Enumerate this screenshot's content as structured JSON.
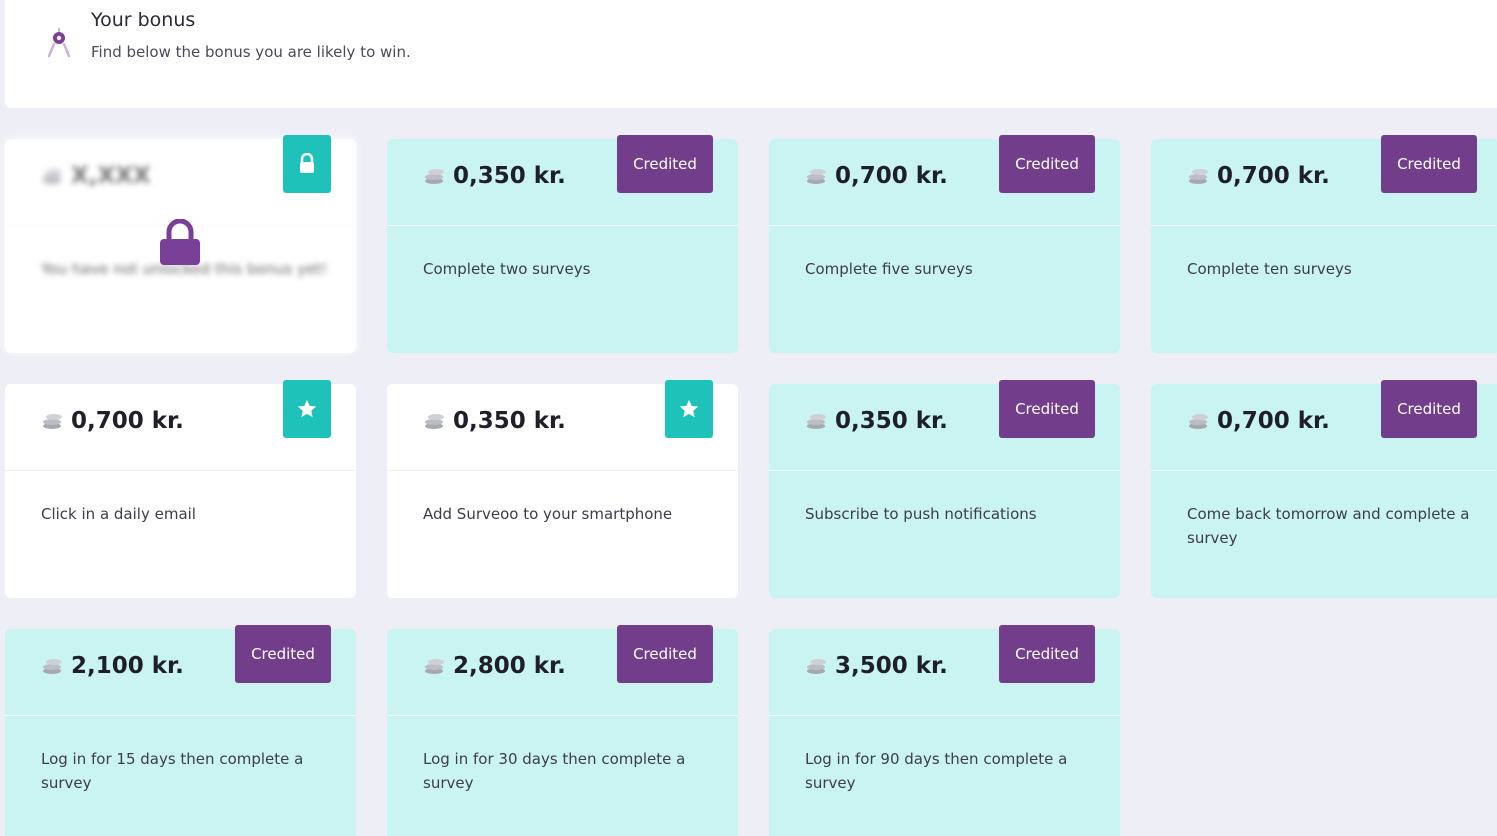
{
  "header": {
    "title": "Your bonus",
    "subtitle": "Find below the bonus you are likely to win.",
    "icon": "compass-pin-icon"
  },
  "colors": {
    "background": "#eeeef6",
    "card_white": "#ffffff",
    "card_teal": "#c9f4f2",
    "credited_badge": "#723e8c",
    "star_badge": "#1ec2b8",
    "lock_purple": "#7a3f96"
  },
  "cards": [
    {
      "amount": "X,XXX",
      "description": "You have not unlocked this bonus yet!",
      "badge": "lock",
      "state": "locked"
    },
    {
      "amount": "0,350 kr.",
      "description": "Complete two surveys",
      "badge": "Credited",
      "state": "credited"
    },
    {
      "amount": "0,700 kr.",
      "description": "Complete five surveys",
      "badge": "Credited",
      "state": "credited"
    },
    {
      "amount": "0,700 kr.",
      "description": "Complete ten surveys",
      "badge": "Credited",
      "state": "credited"
    },
    {
      "amount": "0,700 kr.",
      "description": "Click in a daily email",
      "badge": "star",
      "state": "available"
    },
    {
      "amount": "0,350 kr.",
      "description": "Add Surveoo to your smartphone",
      "badge": "star",
      "state": "available"
    },
    {
      "amount": "0,350 kr.",
      "description": "Subscribe to push notifications",
      "badge": "Credited",
      "state": "credited"
    },
    {
      "amount": "0,700 kr.",
      "description": "Come back tomorrow and complete a survey",
      "badge": "Credited",
      "state": "credited"
    },
    {
      "amount": "2,100 kr.",
      "description": "Log in for 15 days then complete a survey",
      "badge": "Credited",
      "state": "credited"
    },
    {
      "amount": "2,800 kr.",
      "description": "Log in for 30 days then complete a survey",
      "badge": "Credited",
      "state": "credited"
    },
    {
      "amount": "3,500 kr.",
      "description": "Log in for 90 days then complete a survey",
      "badge": "Credited",
      "state": "credited"
    }
  ]
}
